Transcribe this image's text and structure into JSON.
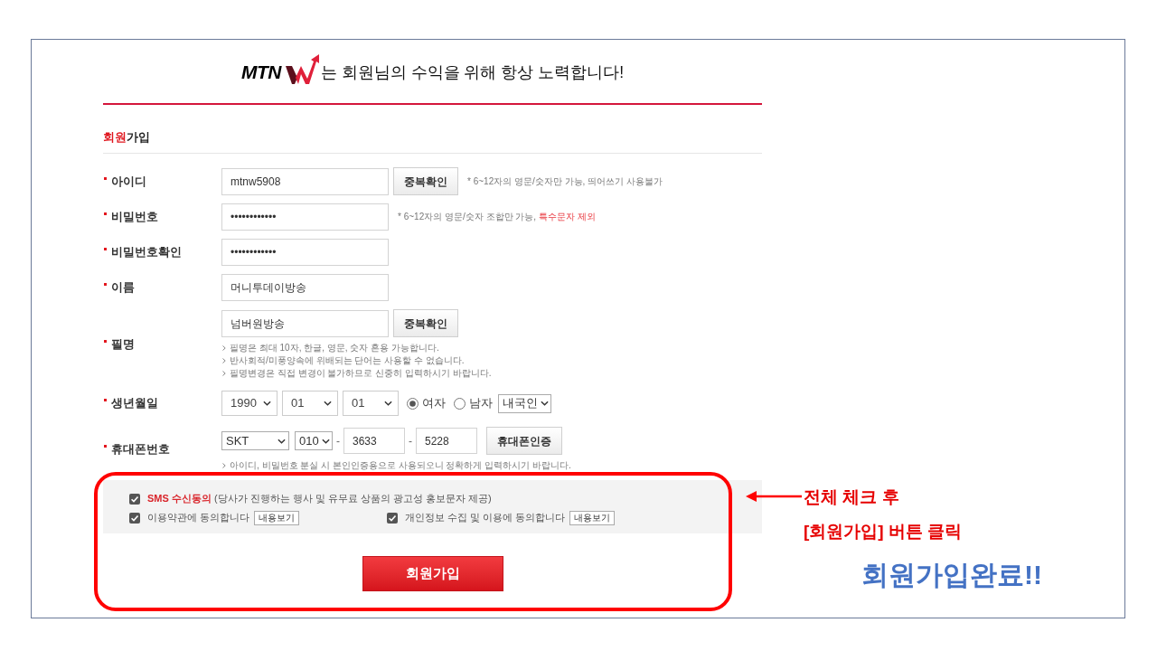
{
  "header": {
    "logo_text": "MTN",
    "tagline": "는 회원님의 수익을 위해 항상 노력합니다!"
  },
  "section_title": [
    {
      "text": "회원",
      "highlight": true
    },
    {
      "text": "가입",
      "highlight": false
    }
  ],
  "fields": [
    {
      "label": "아이디",
      "controls": [
        {
          "kind": "input",
          "value": "mtnw5908"
        },
        {
          "kind": "button",
          "label": "중복확인"
        },
        {
          "kind": "hint",
          "parts": [
            {
              "text": "* 6~12자의 영문/숫자만 가능, 띄어쓰기 사용불가",
              "highlight": false
            }
          ]
        }
      ]
    },
    {
      "label": "비밀번호",
      "controls": [
        {
          "kind": "input",
          "value": "••••••••••••"
        },
        {
          "kind": "hint",
          "parts": [
            {
              "text": "* 6~12자의 영문/숫자 조합만 가능, ",
              "highlight": false
            },
            {
              "text": "특수문자 제외",
              "highlight": true
            }
          ]
        }
      ]
    },
    {
      "label": "비밀번호확인",
      "controls": [
        {
          "kind": "input",
          "value": "••••••••••••"
        }
      ]
    },
    {
      "label": "이름",
      "controls": [
        {
          "kind": "input",
          "value": "머니투데이방송"
        }
      ]
    },
    {
      "label": "필명",
      "controls": [
        {
          "kind": "input",
          "value": "넘버원방송"
        },
        {
          "kind": "button",
          "label": "중복확인"
        }
      ],
      "notes": [
        "필명은 최대 10자, 한글, 영문, 숫자 혼용 가능합니다.",
        "반사회적/미풍양속에 위배되는 단어는 사용할 수 없습니다.",
        "필명변경은 직접 변경이 불가하므로 신중히 입력하시기 바랍니다."
      ]
    },
    {
      "label": "생년월일",
      "controls": [
        {
          "kind": "select",
          "value": "1990"
        },
        {
          "kind": "select",
          "value": "01"
        },
        {
          "kind": "select",
          "value": "01"
        },
        {
          "kind": "radio",
          "label": "여자",
          "selected": true
        },
        {
          "kind": "radio",
          "label": "남자",
          "selected": false
        },
        {
          "kind": "mini_select",
          "value": "내국인"
        }
      ]
    },
    {
      "label": "휴대폰번호",
      "controls": [
        {
          "kind": "mini_select",
          "value": "SKT"
        },
        {
          "kind": "mini_select",
          "value": "010"
        },
        {
          "kind": "separator",
          "text": "-"
        },
        {
          "kind": "short_input",
          "value": "3633"
        },
        {
          "kind": "separator",
          "text": "-"
        },
        {
          "kind": "short_input",
          "value": "5228"
        },
        {
          "kind": "button",
          "label": "휴대폰인증"
        }
      ],
      "notes": [
        "아이디, 비밀번호 분실 시 본인인증용으로 사용되오니 정확하게 입력하시기 바랍니다."
      ]
    }
  ],
  "consents": [
    [
      {
        "checked": true,
        "label": [
          {
            "text": "SMS 수신동의",
            "highlight": true
          },
          {
            "text": " (당사가 진행하는 행사 및 유무료 상품의 광고성 홍보문자 제공)",
            "highlight": false
          }
        ]
      }
    ],
    [
      {
        "checked": true,
        "label": [
          {
            "text": "이용약관에 동의합니다",
            "highlight": false
          }
        ],
        "button": "내용보기"
      },
      {
        "checked": true,
        "label": [
          {
            "text": "개인정보 수집 및 이용에 동의합니다",
            "highlight": false
          }
        ],
        "button": "내용보기"
      }
    ]
  ],
  "submit_button": "회원가입",
  "annotation": {
    "callout": [
      "전체 체크 후",
      "[회원가입] 버튼 클릭"
    ],
    "result": "회원가입완료!!"
  }
}
